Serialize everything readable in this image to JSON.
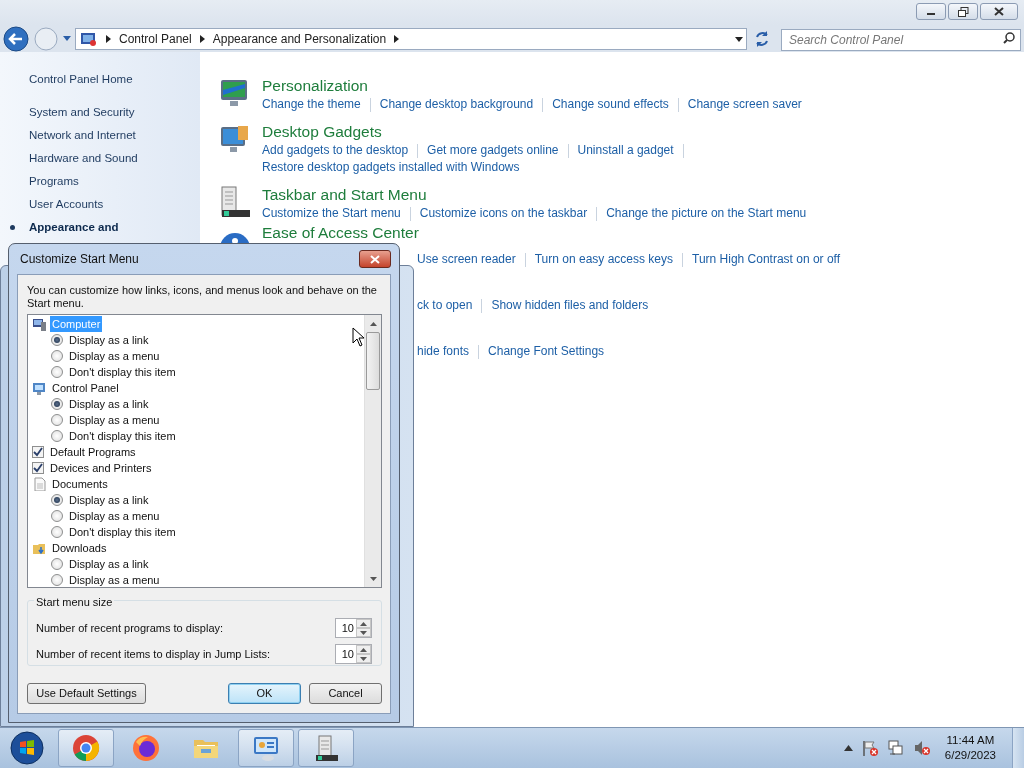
{
  "address_bar": {
    "breadcrumbs": [
      "Control Panel",
      "Appearance and Personalization"
    ]
  },
  "search": {
    "placeholder": "Search Control Panel"
  },
  "sidebar": {
    "home": "Control Panel Home",
    "items": [
      {
        "label": "System and Security",
        "selected": false
      },
      {
        "label": "Network and Internet",
        "selected": false
      },
      {
        "label": "Hardware and Sound",
        "selected": false
      },
      {
        "label": "Programs",
        "selected": false
      },
      {
        "label": "User Accounts",
        "selected": false
      },
      {
        "label": "Appearance and",
        "selected": true
      }
    ]
  },
  "categories": [
    {
      "kind": "personalization",
      "title": "Personalization",
      "partial": false,
      "link_rows": [
        [
          "Change the theme",
          "Change desktop background",
          "Change sound effects",
          "Change screen saver"
        ]
      ]
    },
    {
      "kind": "gadgets",
      "title": "Desktop Gadgets",
      "partial": false,
      "link_rows": [
        [
          "Add gadgets to the desktop",
          "Get more gadgets online",
          "Uninstall a gadget"
        ],
        [
          "Restore desktop gadgets installed with Windows"
        ]
      ]
    },
    {
      "kind": "taskbar",
      "title": "Taskbar and Start Menu",
      "partial": false,
      "link_rows": [
        [
          "Customize the Start menu",
          "Customize icons on the taskbar",
          "Change the picture on the Start menu"
        ]
      ]
    },
    {
      "kind": "ease",
      "title": "Ease of Access Center",
      "partial": true,
      "link_rows": [
        [
          "Use screen reader",
          "Turn on easy access keys",
          "Turn High Contrast on or off"
        ]
      ]
    },
    {
      "kind": "folder",
      "partial": true,
      "link_rows": [
        [
          "ck to open",
          "Show hidden files and folders"
        ]
      ]
    },
    {
      "kind": "fonts",
      "partial": true,
      "link_rows": [
        [
          "hide fonts",
          "Change Font Settings"
        ]
      ]
    }
  ],
  "dialog": {
    "title": "Customize Start Menu",
    "description": "You can customize how links, icons, and menus look and behave on the Start menu.",
    "tree": [
      {
        "kind": "computer",
        "label": "Computer",
        "selected": true,
        "children": [
          {
            "kind": "radio",
            "label": "Display as a link",
            "checked": true
          },
          {
            "kind": "radio",
            "label": "Display as a menu",
            "checked": false
          },
          {
            "kind": "radio",
            "label": "Don't display this item",
            "checked": false
          }
        ]
      },
      {
        "kind": "controlpanel",
        "label": "Control Panel",
        "selected": false,
        "children": [
          {
            "kind": "radio",
            "label": "Display as a link",
            "checked": true
          },
          {
            "kind": "radio",
            "label": "Display as a menu",
            "checked": false
          },
          {
            "kind": "radio",
            "label": "Don't display this item",
            "checked": false
          }
        ]
      },
      {
        "kind": "checkbox",
        "label": "Default Programs",
        "checked": true
      },
      {
        "kind": "checkbox",
        "label": "Devices and Printers",
        "checked": true
      },
      {
        "kind": "documents",
        "label": "Documents",
        "selected": false,
        "children": [
          {
            "kind": "radio",
            "label": "Display as a link",
            "checked": true
          },
          {
            "kind": "radio",
            "label": "Display as a menu",
            "checked": false
          },
          {
            "kind": "radio",
            "label": "Don't display this item",
            "checked": false
          }
        ]
      },
      {
        "kind": "downloads",
        "label": "Downloads",
        "selected": false,
        "children": [
          {
            "kind": "radio",
            "label": "Display as a link",
            "checked": false
          },
          {
            "kind": "radio",
            "label": "Display as a menu",
            "checked": false
          }
        ]
      }
    ],
    "size_group": {
      "title": "Start menu size",
      "fields": [
        {
          "label": "Number of recent programs to display:",
          "value": "10"
        },
        {
          "label": "Number of recent items to display in Jump Lists:",
          "value": "10"
        }
      ]
    },
    "buttons": [
      {
        "label": "Use Default Settings",
        "default": false
      },
      {
        "label": "OK",
        "default": true
      },
      {
        "label": "Cancel",
        "default": false
      }
    ]
  },
  "taskbar": {
    "apps": [
      {
        "kind": "chrome",
        "running": true
      },
      {
        "kind": "firefox",
        "running": false
      },
      {
        "kind": "explorer",
        "running": false
      },
      {
        "kind": "controlpanel",
        "running": true
      },
      {
        "kind": "taskbarprops",
        "running": true
      }
    ],
    "clock": {
      "time": "11:44 AM",
      "date": "6/29/2023"
    }
  }
}
